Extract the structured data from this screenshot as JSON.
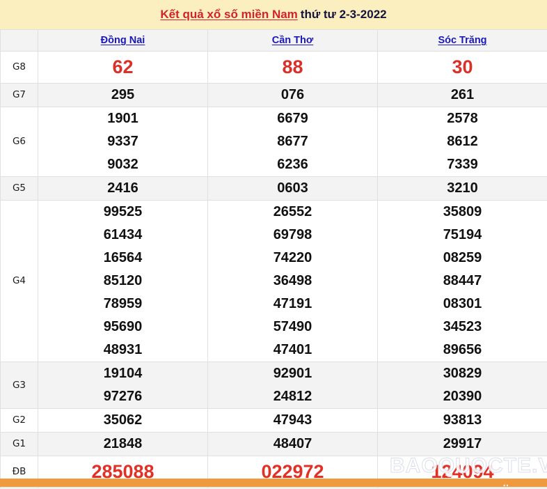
{
  "page": {
    "title_main": "Kết quả xổ số miền Nam",
    "title_sub": "thứ tư 2-3-2022",
    "watermark": "BAOQUOCTE.VN",
    "footer_glyph": "..",
    "colors": {
      "banner_bg": "#fbefc0",
      "title_red": "#d0232b",
      "title_dark": "#14143c",
      "province_link": "#1a19b6",
      "prize_red": "#d9302a",
      "row_gray": "#f3f3f3",
      "row_white": "#ffffff",
      "border": "#e0e0e0",
      "footer_orange": "#f09a3e"
    }
  },
  "table": {
    "corner_label": "",
    "provinces": [
      "Đồng Nai",
      "Cần Thơ",
      "Sóc Trăng"
    ],
    "rows": [
      {
        "label": "G8",
        "shade": "white",
        "style": "big-red",
        "values": [
          [
            "62"
          ],
          [
            "88"
          ],
          [
            "30"
          ]
        ]
      },
      {
        "label": "G7",
        "shade": "gray",
        "style": "normal",
        "values": [
          [
            "295"
          ],
          [
            "076"
          ],
          [
            "261"
          ]
        ]
      },
      {
        "label": "G6",
        "shade": "white",
        "style": "normal",
        "values": [
          [
            "1901",
            "9337",
            "9032"
          ],
          [
            "6679",
            "8677",
            "6236"
          ],
          [
            "2578",
            "8612",
            "7339"
          ]
        ]
      },
      {
        "label": "G5",
        "shade": "gray",
        "style": "normal",
        "values": [
          [
            "2416"
          ],
          [
            "0603"
          ],
          [
            "3210"
          ]
        ]
      },
      {
        "label": "G4",
        "shade": "white",
        "style": "normal",
        "values": [
          [
            "99525",
            "61434",
            "16564",
            "85120",
            "78959",
            "95690",
            "48931"
          ],
          [
            "26552",
            "69798",
            "74220",
            "36498",
            "47191",
            "57490",
            "47401"
          ],
          [
            "35809",
            "75194",
            "08259",
            "88447",
            "08301",
            "34523",
            "89656"
          ]
        ]
      },
      {
        "label": "G3",
        "shade": "gray",
        "style": "normal",
        "values": [
          [
            "19104",
            "97276"
          ],
          [
            "92901",
            "24812"
          ],
          [
            "30829",
            "20390"
          ]
        ]
      },
      {
        "label": "G2",
        "shade": "white",
        "style": "normal",
        "values": [
          [
            "35062"
          ],
          [
            "47943"
          ],
          [
            "93813"
          ]
        ]
      },
      {
        "label": "G1",
        "shade": "gray",
        "style": "normal",
        "values": [
          [
            "21848"
          ],
          [
            "48407"
          ],
          [
            "29917"
          ]
        ]
      },
      {
        "label": "ĐB",
        "shade": "white",
        "style": "db-red",
        "values": [
          [
            "285088"
          ],
          [
            "022972"
          ],
          [
            "124094"
          ]
        ]
      }
    ]
  }
}
